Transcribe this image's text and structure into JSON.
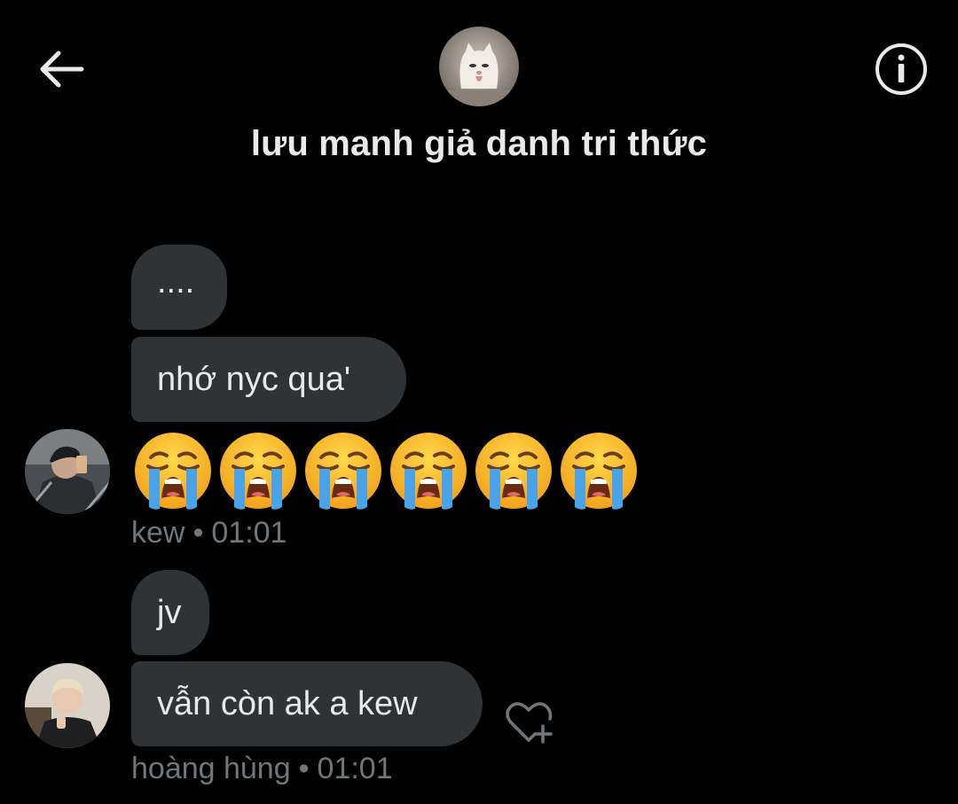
{
  "header": {
    "back_icon": "arrow-left-icon",
    "info_icon": "info-circle-icon",
    "group_avatar": "cat-photo",
    "title": "lưu manh giả danh tri thức"
  },
  "messages": [
    {
      "sender": "kew",
      "text": "...."
    },
    {
      "sender": "kew",
      "text": "nhớ nyc qua'"
    },
    {
      "sender": "kew",
      "emoji": "loudly-crying-face",
      "emoji_count": 6
    }
  ],
  "meta_kew": {
    "name": "kew",
    "separator": "•",
    "time": "01:01"
  },
  "messages2": [
    {
      "sender": "hoàng hùng",
      "text": "jv"
    },
    {
      "sender": "hoàng hùng",
      "text": "vẫn còn ak a kew"
    }
  ],
  "meta_hung": {
    "name": "hoàng hùng",
    "separator": "•",
    "time": "01:01"
  },
  "reaction_icon": "heart-plus-icon",
  "colors": {
    "background": "#000000",
    "bubble": "#2f3336",
    "text": "#e7e9ea",
    "meta": "#71767b"
  }
}
